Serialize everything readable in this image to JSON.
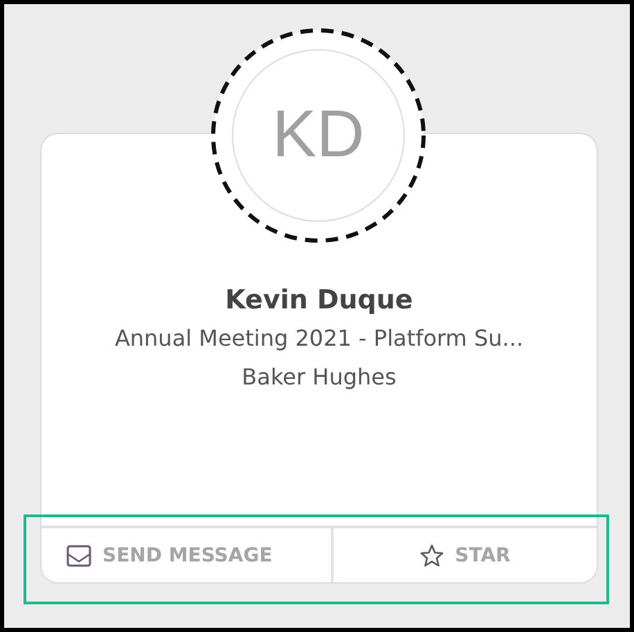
{
  "profile": {
    "initials": "KD",
    "name": "Kevin Duque",
    "event": "Annual Meeting 2021 - Platform Su...",
    "company": "Baker Hughes"
  },
  "actions": [
    {
      "kind": "message",
      "label": "SEND MESSAGE"
    },
    {
      "kind": "star",
      "label": "STAR"
    }
  ]
}
